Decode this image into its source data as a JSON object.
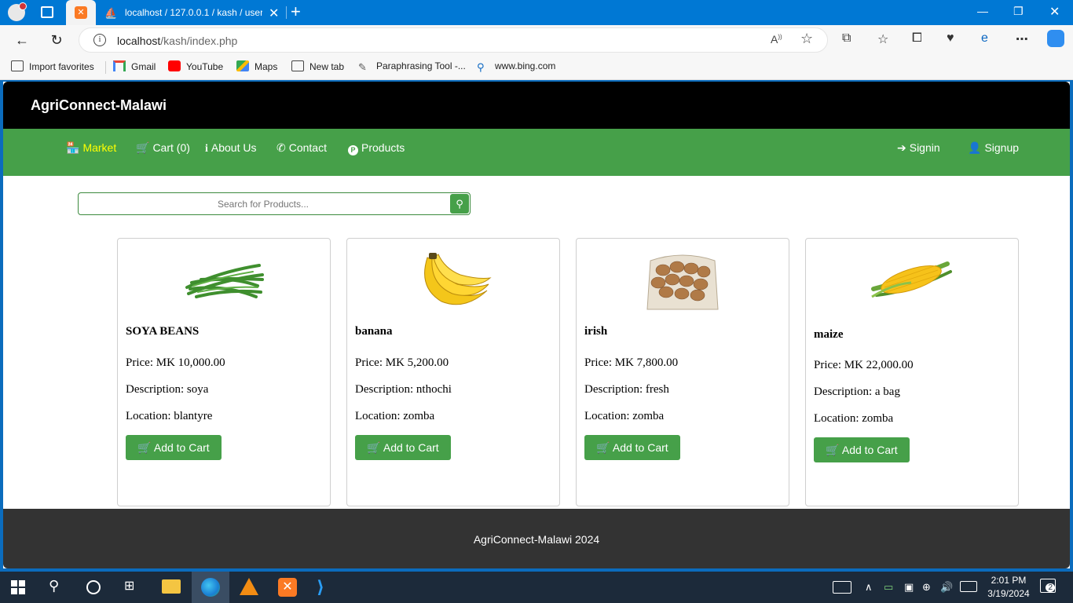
{
  "browser": {
    "tab_title": "localhost / 127.0.0.1 / kash / user",
    "url_host": "localhost",
    "url_path": "/kash/index.php",
    "favorites": [
      "Import favorites",
      "Gmail",
      "YouTube",
      "Maps",
      "New tab",
      "Paraphrasing Tool -...",
      "www.bing.com"
    ]
  },
  "site": {
    "title": "AgriConnect-Malawi",
    "nav": {
      "market": "Market",
      "cart": "Cart (0)",
      "about": "About Us",
      "contact": "Contact",
      "products": "Products",
      "signin": "Signin",
      "signup": "Signup"
    },
    "search_placeholder": "Search for Products...",
    "footer": "AgriConnect-Malawi 2024",
    "accent_color": "#46a049",
    "active_nav_color": "#ffff00"
  },
  "products": [
    {
      "name": "SOYA BEANS",
      "price": "Price: MK 10,000.00",
      "description": "Description: soya",
      "location": "Location: blantyre",
      "button": "Add to Cart",
      "image": "green-beans-image"
    },
    {
      "name": "banana",
      "price": "Price: MK 5,200.00",
      "description": "Description: nthochi",
      "location": "Location: zomba",
      "button": "Add to Cart",
      "image": "banana-image"
    },
    {
      "name": "irish",
      "price": "Price: MK 7,800.00",
      "description": "Description: fresh",
      "location": "Location: zomba",
      "button": "Add to Cart",
      "image": "potato-sack-image"
    },
    {
      "name": "maize",
      "price": "Price: MK 22,000.00",
      "description": "Description: a bag",
      "location": "Location: zomba",
      "button": "Add to Cart",
      "image": "maize-cob-image"
    }
  ],
  "taskbar": {
    "time": "2:01 PM",
    "date": "3/19/2024",
    "notifications": "2"
  }
}
